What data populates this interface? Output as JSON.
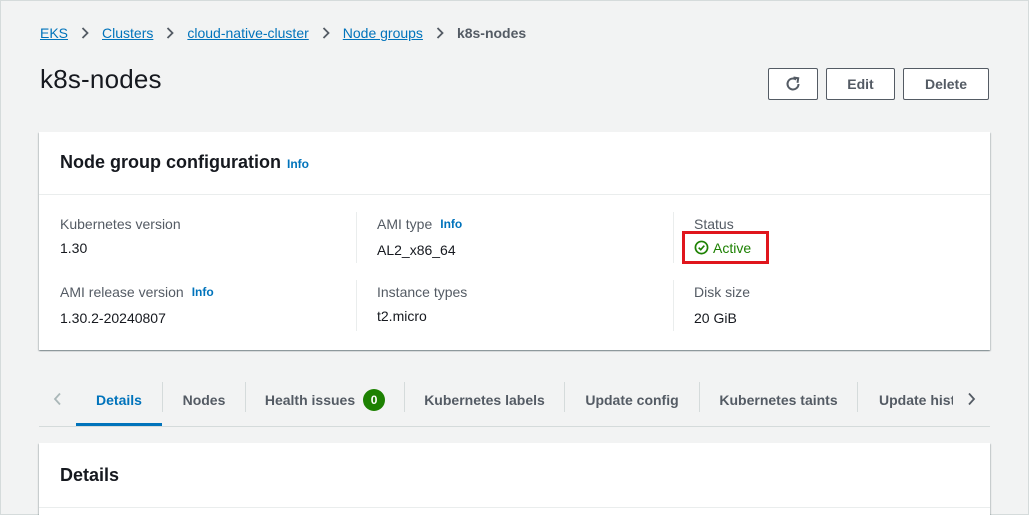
{
  "breadcrumb": {
    "items": [
      "EKS",
      "Clusters",
      "cloud-native-cluster",
      "Node groups"
    ],
    "current": "k8s-nodes"
  },
  "header": {
    "title": "k8s-nodes",
    "refresh_icon": "refresh-icon",
    "edit_label": "Edit",
    "delete_label": "Delete"
  },
  "config": {
    "title": "Node group configuration",
    "info_label": "Info",
    "fields": {
      "kubernetes_version": {
        "label": "Kubernetes version",
        "value": "1.30"
      },
      "ami_type": {
        "label": "AMI type",
        "info": "Info",
        "value": "AL2_x86_64"
      },
      "status": {
        "label": "Status",
        "value": "Active",
        "icon": "check-circle-icon",
        "color": "#1d8102"
      },
      "ami_release_version": {
        "label": "AMI release version",
        "info": "Info",
        "value": "1.30.2-20240807"
      },
      "instance_types": {
        "label": "Instance types",
        "value": "t2.micro"
      },
      "disk_size": {
        "label": "Disk size",
        "value": "20 GiB"
      }
    }
  },
  "tabs": {
    "items": [
      "Details",
      "Nodes",
      "Health issues",
      "Kubernetes labels",
      "Update config",
      "Kubernetes taints",
      "Update hist"
    ],
    "active": "Details",
    "health_issues_count": "0"
  },
  "details": {
    "title": "Details"
  },
  "colors": {
    "link": "#0073bb",
    "success": "#1d8102",
    "highlight": "#e0161d",
    "background": "#f2f3f3"
  }
}
